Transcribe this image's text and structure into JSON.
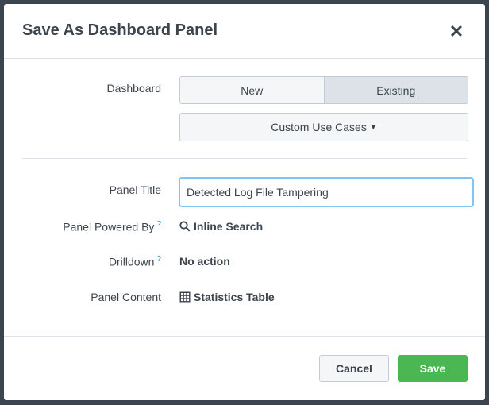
{
  "modal": {
    "title": "Save As Dashboard Panel",
    "close_icon": "close-icon"
  },
  "form": {
    "dashboard_label": "Dashboard",
    "dashboard_options": [
      "New",
      "Existing"
    ],
    "dashboard_selected": "Existing",
    "dashboard_select_value": "Custom Use Cases",
    "panel_title_label": "Panel Title",
    "panel_title_value": "Detected Log File Tampering",
    "powered_by_label": "Panel Powered By",
    "powered_by_help": "?",
    "powered_by_value": "Inline Search",
    "drilldown_label": "Drilldown",
    "drilldown_help": "?",
    "drilldown_value": "No action",
    "content_label": "Panel Content",
    "content_value": "Statistics Table"
  },
  "footer": {
    "cancel_label": "Cancel",
    "save_label": "Save"
  },
  "colors": {
    "save": "#4bb752",
    "focus": "#7fc4f2",
    "help": "#1a9bd6"
  }
}
